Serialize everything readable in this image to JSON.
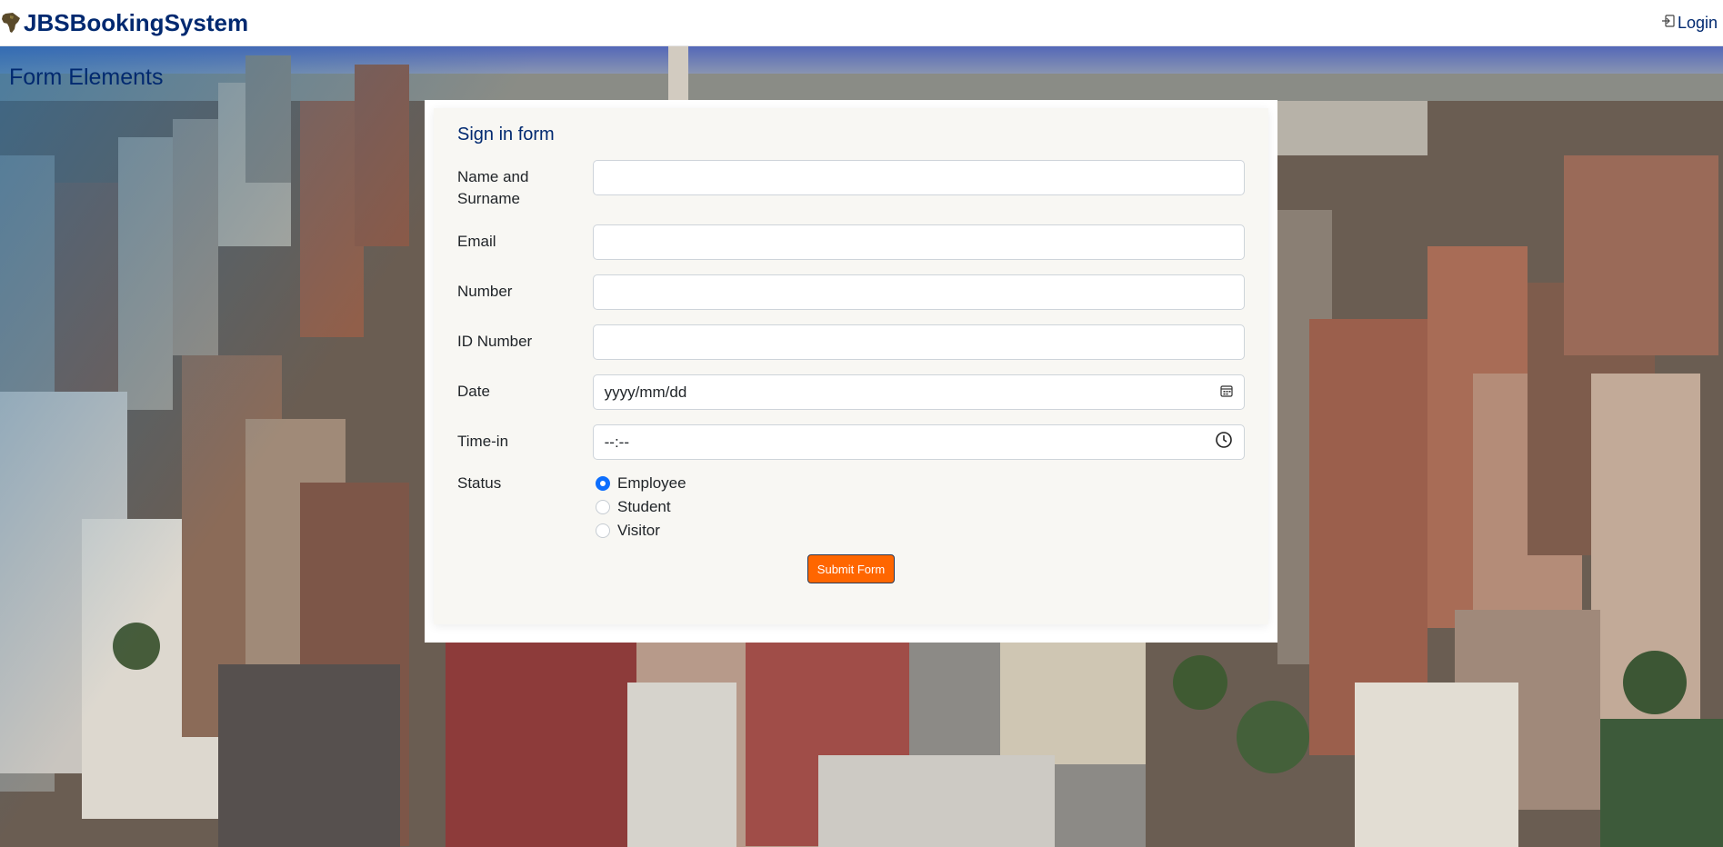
{
  "header": {
    "brand": "JBSBookingSystem",
    "login_label": "Login"
  },
  "page": {
    "title": "Form Elements"
  },
  "form": {
    "title": "Sign in form",
    "fields": [
      {
        "label": "Name and Surname",
        "value": "",
        "placeholder": ""
      },
      {
        "label": "Email",
        "value": "",
        "placeholder": ""
      },
      {
        "label": "Number",
        "value": "",
        "placeholder": ""
      },
      {
        "label": "ID Number",
        "value": "",
        "placeholder": ""
      },
      {
        "label": "Date",
        "value": "yyyy/mm/dd",
        "icon": "calendar-icon"
      },
      {
        "label": "Time-in",
        "value": "--:--",
        "icon": "clock-icon"
      }
    ],
    "status": {
      "label": "Status",
      "options": [
        "Employee",
        "Student",
        "Visitor"
      ],
      "selected": "Employee"
    },
    "submit_label": "Submit Form"
  },
  "colors": {
    "brand": "#012970",
    "accent": "#ff6600",
    "radio_selected": "#0d6efd",
    "card_bg": "#f8f7f3"
  }
}
